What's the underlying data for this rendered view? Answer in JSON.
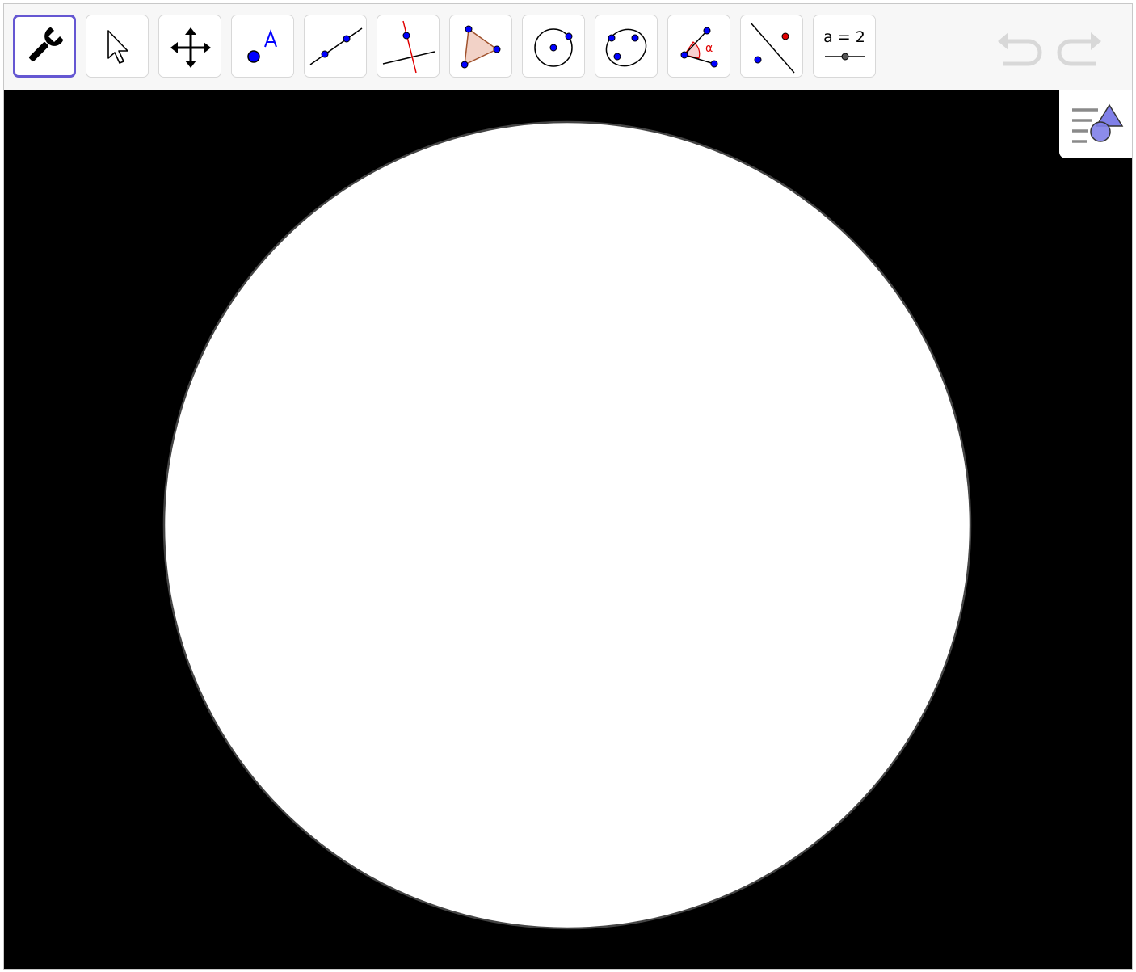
{
  "toolbar": {
    "tools": [
      {
        "id": "tools",
        "icon": "wrench-icon",
        "selected": true
      },
      {
        "id": "move",
        "icon": "cursor-arrow-icon",
        "selected": false
      },
      {
        "id": "move-graphics-view",
        "icon": "move-arrows-icon",
        "selected": false
      },
      {
        "id": "point",
        "icon": "point-icon",
        "label": "A",
        "selected": false
      },
      {
        "id": "line",
        "icon": "line-through-points-icon",
        "selected": false
      },
      {
        "id": "perpendicular-line",
        "icon": "perpendicular-line-icon",
        "selected": false
      },
      {
        "id": "polygon",
        "icon": "polygon-icon",
        "selected": false
      },
      {
        "id": "circle-center-point",
        "icon": "circle-center-point-icon",
        "selected": false
      },
      {
        "id": "ellipse",
        "icon": "ellipse-icon",
        "selected": false
      },
      {
        "id": "angle",
        "icon": "angle-icon",
        "label": "α",
        "selected": false
      },
      {
        "id": "reflect-about-line",
        "icon": "reflect-about-line-icon",
        "selected": false
      },
      {
        "id": "slider",
        "icon": "slider-icon",
        "label": "a = 2",
        "selected": false
      }
    ],
    "undo_icon": "undo-icon",
    "redo_icon": "redo-icon"
  },
  "graphics": {
    "background_color": "#000000",
    "circle_fill": "#ffffff",
    "circle_stroke": "#444444",
    "style_bar_icon": "style-bar-toggle-icon"
  },
  "colors": {
    "accent": "#6557d2",
    "point_blue": "#0000ff",
    "highlight_red": "#e00000",
    "polygon_fill": "#f2d2c7",
    "polygon_stroke": "#a0522d",
    "disabled_gray": "#d8d8d8"
  }
}
